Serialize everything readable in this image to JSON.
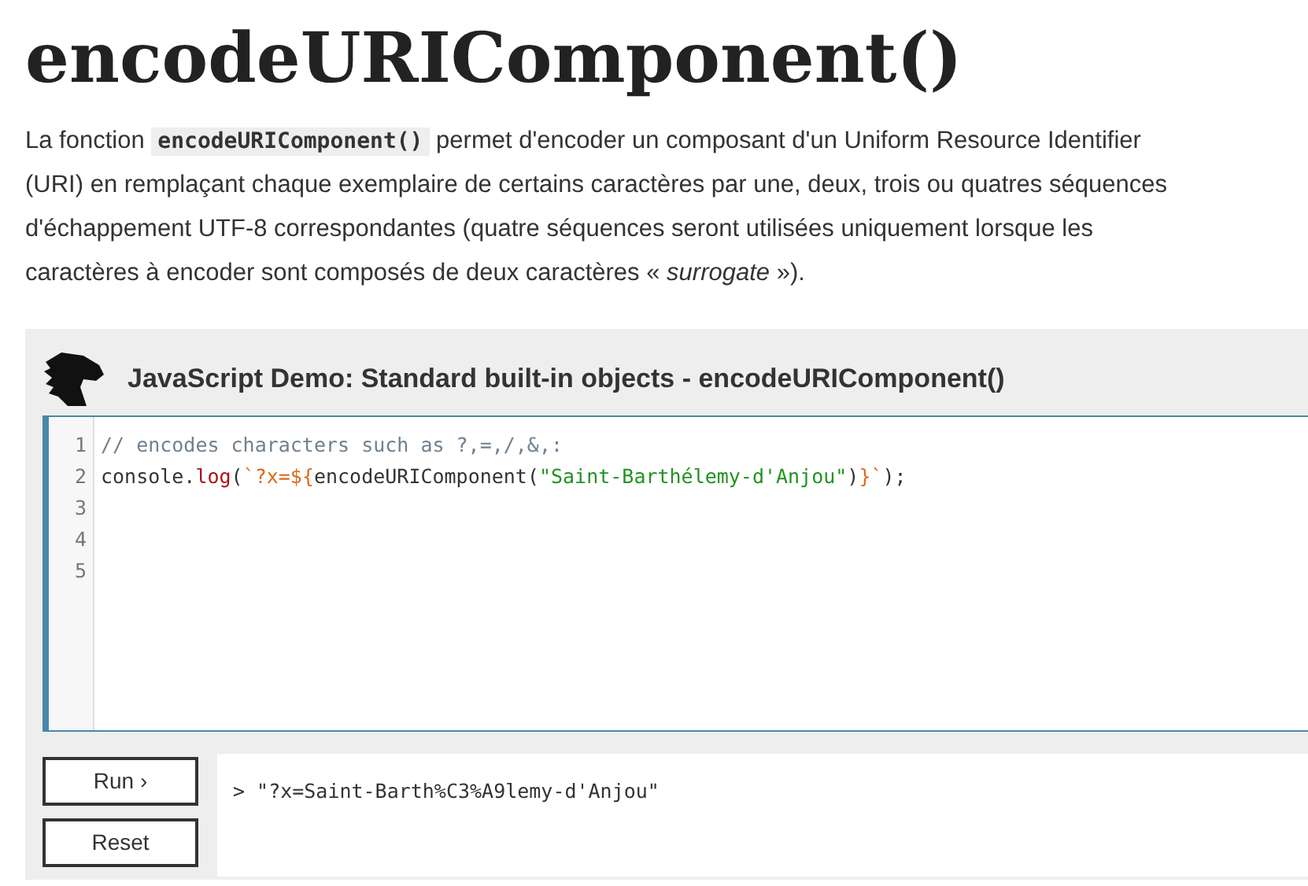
{
  "title": "encodeURIComponent()",
  "intro": [
    {
      "kind": "text",
      "text": "La fonction "
    },
    {
      "kind": "code",
      "text": "encodeURIComponent()"
    },
    {
      "kind": "text",
      "text": " permet d'encoder un composant d'un Uniform Resource Identifier (URI) en remplaçant chaque exemplaire de certains caractères par une, deux, trois ou quatres séquences d'échappement UTF-8 correspondantes (quatre séquences seront utilisées uniquement lorsque les caractères à encoder sont composés de deux caractères « *surrogate* »)."
    }
  ],
  "demo": {
    "title": "JavaScript Demo: Standard built-in objects - encodeURIComponent()",
    "lines": [
      {
        "number": "1",
        "tokens": [
          {
            "kind": "comment",
            "text": "// encodes characters such as ?,=,/,&,:"
          }
        ]
      },
      {
        "number": "2",
        "tokens": [
          {
            "kind": "plain",
            "text": "console."
          },
          {
            "kind": "property",
            "text": "log"
          },
          {
            "kind": "plain",
            "text": "("
          },
          {
            "kind": "template",
            "text": "`?x=${"
          },
          {
            "kind": "plain",
            "text": "encodeURIComponent("
          },
          {
            "kind": "string",
            "text": "\"Saint-Barthélemy-d'Anjou\""
          },
          {
            "kind": "plain",
            "text": ")"
          },
          {
            "kind": "template",
            "text": "}`"
          },
          {
            "kind": "plain",
            "text": ");"
          }
        ]
      },
      {
        "number": "3"
      },
      {
        "number": "4"
      },
      {
        "number": "5"
      }
    ],
    "buttons": [
      "Run ›",
      "Reset"
    ],
    "output": "> \"?x=Saint-Barth%C3%A9lemy-d'Anjou\""
  }
}
